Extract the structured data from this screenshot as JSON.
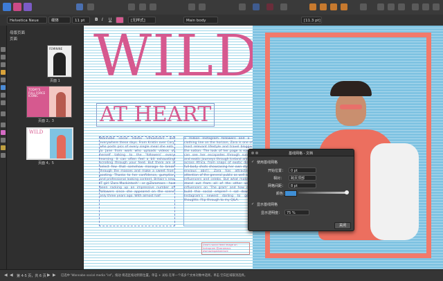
{
  "toolbar": {
    "zoom_label": "◂▸"
  },
  "context": {
    "font_family": "Helvetica Neue",
    "font_style": "细体",
    "font_size": "11 pt",
    "bold": "B",
    "italic": "I",
    "underline": "U",
    "char_style": "[无样式]",
    "para_style": "Main body",
    "pt_field": "[11.3 pt]"
  },
  "pages_panel": {
    "master_pages": "母版页面",
    "pages": "页面",
    "thumb1_label": "页面 1",
    "thumb2_label": "页面 2，3",
    "thumb3_label": "页面 4，5",
    "thumb2_text": "TODAY'S FULL FORCE ICONIC",
    "thumb3_text": "WILD",
    "thumb1_text": "FEMININE"
  },
  "document": {
    "headline": "WILD",
    "subheadline": "AT HEART",
    "column1": "Wannabe social media 'influencers' are everywhere these days. From Kristin over Cory who posts pics of every single meal she eats, to Jane from work who uploads videos of herself talking to the 'followers' every morning. It can often feel a bit exhausting scrolling through your feed. But there are a select few that somehow manage to break through the masses and make a sweet from posting. Thanks to her confidence, gumption and professional looking content, Britain's new IT girl 'Zara Mackintosh' - or @Zaramacs - has been racking up an impressive number of followers since she appeared on the scene only three years ago. With almost half",
    "column2": "a million Instagram followers and a new clothing line on the horizon, Zara is one of the most relevant lifestyle and travel bloggers in the nation. The look of her page is easy, you can see her escapades through sun-kissed and exotic journeys through Iceland and Island across Africa, from snaps of exotic dishes to full-body shots showcasing her own style (and envious abs!). Zara has attracted the attention of the general public as well as other influencers and celebs. But what makes Zara stand out from all of the other wannabe influencers on 'The gram' and how did she build this social empire? I sat down with Instagram's newest darling to get her thoughts. Flip through to my Q&A.",
    "caption": "Zara's social feed image on Instagram @zaramacs #amazingadventure"
  },
  "dialog": {
    "title": "基线网格 - 文档",
    "use_grid": "使用基线网格",
    "start_label": "开始位置：",
    "start_value": "0 pt",
    "relative_label": "相对：",
    "relative_value": "跨页顶部",
    "spacing_label": "网格间距：",
    "spacing_value": "8 pt",
    "color_label": "颜色：",
    "show_grid": "显示基线网格",
    "opacity_label": "显示透明度：",
    "opacity_value": "75 %",
    "close": "关闭",
    "swatch": "#3f8fd6"
  },
  "status": {
    "pages": "第 4-5 页，共 6 页",
    "hint": "已选中 'Wannabe social media \"inf'。拖动 将选区拖动到新位置。单击 + 光标 在单一个或多个文本对象中选择。单击 空白区域取消选择。"
  },
  "colors": {
    "headline": "#d6598f",
    "frame": "#f27a6b",
    "sky": "#7fc3e2",
    "body_text": "#5a6aa8"
  }
}
